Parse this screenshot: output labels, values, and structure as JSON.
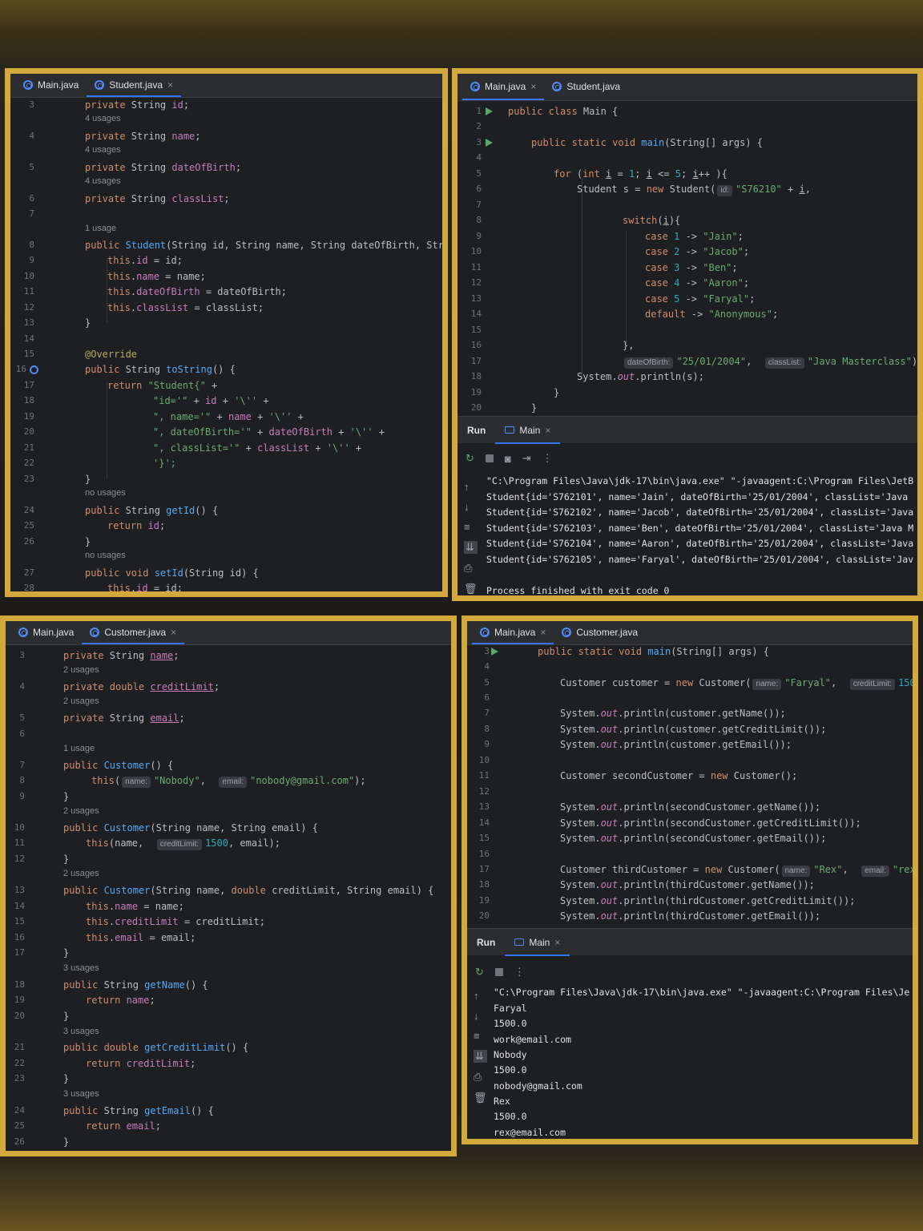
{
  "panel1": {
    "tabs": [
      {
        "label": "Main.java"
      },
      {
        "label": "Student.java",
        "close": "×"
      }
    ],
    "lines": [
      {
        "n": "3",
        "code": "private String id;",
        "hint": "4 usages"
      },
      {
        "n": "4",
        "code": "private String name;",
        "hint": "4 usages"
      },
      {
        "n": "5",
        "code": "private String dateOfBirth;",
        "hint": "4 usages"
      },
      {
        "n": "6",
        "code": "private String classList;"
      },
      {
        "n": "7",
        "code": "",
        "hint": "1 usage"
      },
      {
        "n": "8",
        "code": "public Student(String id, String name, String dateOfBirth, String"
      },
      {
        "n": "9",
        "code": "this.id = id;"
      },
      {
        "n": "10",
        "code": "this.name = name;"
      },
      {
        "n": "11",
        "code": "this.dateOfBirth = dateOfBirth;"
      },
      {
        "n": "12",
        "code": "this.classList = classList;"
      },
      {
        "n": "13",
        "code": "}"
      },
      {
        "n": "14",
        "code": ""
      },
      {
        "n": "15",
        "code": "@Override"
      },
      {
        "n": "16",
        "code": "public String toString() {"
      },
      {
        "n": "17",
        "code": "return \"Student{\" +"
      },
      {
        "n": "18",
        "code": "\"id='\" + id + '\\'' +"
      },
      {
        "n": "19",
        "code": "\", name='\" + name + '\\'' +"
      },
      {
        "n": "20",
        "code": "\", dateOfBirth='\" + dateOfBirth + '\\'' +"
      },
      {
        "n": "21",
        "code": "\", classList='\" + classList + '\\'' +"
      },
      {
        "n": "22",
        "code": "'}';"
      },
      {
        "n": "23",
        "code": "}",
        "hint": "no usages"
      },
      {
        "n": "24",
        "code": "public String getId() {"
      },
      {
        "n": "25",
        "code": "return id;"
      },
      {
        "n": "26",
        "code": "}",
        "hint": "no usages"
      },
      {
        "n": "27",
        "code": "public void setId(String id) {"
      },
      {
        "n": "28",
        "code": "this.id = id;"
      }
    ]
  },
  "panel2": {
    "tabs": [
      {
        "label": "Main.java",
        "close": "×"
      },
      {
        "label": "Student.java"
      }
    ],
    "lines": [
      {
        "n": "1",
        "code": "public class Main {"
      },
      {
        "n": "2",
        "code": ""
      },
      {
        "n": "3",
        "code": "public static void main(String[] args) {"
      },
      {
        "n": "4",
        "code": ""
      },
      {
        "n": "5",
        "code": "for (int i = 1; i <= 5; i++ ){"
      },
      {
        "n": "6",
        "code": "Student s = new Student( id: \"S76210\" + i,"
      },
      {
        "n": "7",
        "code": ""
      },
      {
        "n": "8",
        "code": "switch(i){"
      },
      {
        "n": "9",
        "code": "case 1 -> \"Jain\";"
      },
      {
        "n": "10",
        "code": "case 2 -> \"Jacob\";"
      },
      {
        "n": "11",
        "code": "case 3 -> \"Ben\";"
      },
      {
        "n": "12",
        "code": "case 4 -> \"Aaron\";"
      },
      {
        "n": "13",
        "code": "case 5 -> \"Faryal\";"
      },
      {
        "n": "14",
        "code": "default -> \"Anonymous\";"
      },
      {
        "n": "15",
        "code": ""
      },
      {
        "n": "16",
        "code": "},"
      },
      {
        "n": "17",
        "code": "dateOfBirth: \"25/01/2004\",  classList: \"Java Masterclass\");"
      },
      {
        "n": "18",
        "code": "System.out.println(s);"
      },
      {
        "n": "19",
        "code": "}"
      },
      {
        "n": "20",
        "code": "}"
      }
    ],
    "run": {
      "label": "Run",
      "tab": "Main",
      "close": "×",
      "output": [
        "\"C:\\Program Files\\Java\\jdk-17\\bin\\java.exe\" \"-javaagent:C:\\Program Files\\JetB",
        "Student{id='S762101', name='Jain', dateOfBirth='25/01/2004', classList='Java",
        "Student{id='S762102', name='Jacob', dateOfBirth='25/01/2004', classList='Java",
        "Student{id='S762103', name='Ben', dateOfBirth='25/01/2004', classList='Java M",
        "Student{id='S762104', name='Aaron', dateOfBirth='25/01/2004', classList='Java",
        "Student{id='S762105', name='Faryal', dateOfBirth='25/01/2004', classList='Jav",
        "",
        "Process finished with exit code 0"
      ]
    }
  },
  "panel3": {
    "tabs": [
      {
        "label": "Main.java"
      },
      {
        "label": "Customer.java",
        "close": "×"
      }
    ],
    "lines": [
      {
        "n": "3",
        "code": "private String name;",
        "hint": "2 usages"
      },
      {
        "n": "4",
        "code": "private double creditLimit;",
        "hint": "2 usages"
      },
      {
        "n": "5",
        "code": "private String email;"
      },
      {
        "n": "6",
        "code": "",
        "hint": "1 usage"
      },
      {
        "n": "7",
        "code": "public Customer() {"
      },
      {
        "n": "8",
        "code": "this( name: \"Nobody\",  email: \"nobody@gmail.com\");"
      },
      {
        "n": "9",
        "code": "}",
        "hint": "2 usages"
      },
      {
        "n": "10",
        "code": "public Customer(String name, String email) {"
      },
      {
        "n": "11",
        "code": "this(name,  creditLimit: 1500, email);"
      },
      {
        "n": "12",
        "code": "}",
        "hint": "2 usages"
      },
      {
        "n": "13",
        "code": "public Customer(String name, double creditLimit, String email) {"
      },
      {
        "n": "14",
        "code": "this.name = name;"
      },
      {
        "n": "15",
        "code": "this.creditLimit = creditLimit;"
      },
      {
        "n": "16",
        "code": "this.email = email;"
      },
      {
        "n": "17",
        "code": "}",
        "hint": "3 usages"
      },
      {
        "n": "18",
        "code": "public String getName() {"
      },
      {
        "n": "19",
        "code": "return name;"
      },
      {
        "n": "20",
        "code": "}",
        "hint": "3 usages"
      },
      {
        "n": "21",
        "code": "public double getCreditLimit() {"
      },
      {
        "n": "22",
        "code": "return creditLimit;"
      },
      {
        "n": "23",
        "code": "}",
        "hint": "3 usages"
      },
      {
        "n": "24",
        "code": "public String getEmail() {"
      },
      {
        "n": "25",
        "code": "return email;"
      },
      {
        "n": "26",
        "code": "}"
      }
    ]
  },
  "panel4": {
    "tabs": [
      {
        "label": "Main.java",
        "close": "×"
      },
      {
        "label": "Customer.java"
      }
    ],
    "lines": [
      {
        "n": "3",
        "code": "public static void main(String[] args) {"
      },
      {
        "n": "4",
        "code": ""
      },
      {
        "n": "5",
        "code": "Customer customer = new Customer( name: \"Faryal\",  creditLimit: 1500,"
      },
      {
        "n": "6",
        "code": ""
      },
      {
        "n": "7",
        "code": "System.out.println(customer.getName());"
      },
      {
        "n": "8",
        "code": "System.out.println(customer.getCreditLimit());"
      },
      {
        "n": "9",
        "code": "System.out.println(customer.getEmail());"
      },
      {
        "n": "10",
        "code": ""
      },
      {
        "n": "11",
        "code": "Customer secondCustomer = new Customer();"
      },
      {
        "n": "12",
        "code": ""
      },
      {
        "n": "13",
        "code": "System.out.println(secondCustomer.getName());"
      },
      {
        "n": "14",
        "code": "System.out.println(secondCustomer.getCreditLimit());"
      },
      {
        "n": "15",
        "code": "System.out.println(secondCustomer.getEmail());"
      },
      {
        "n": "16",
        "code": ""
      },
      {
        "n": "17",
        "code": "Customer thirdCustomer = new Customer( name: \"Rex\",  email: \"rex@em"
      },
      {
        "n": "18",
        "code": "System.out.println(thirdCustomer.getName());"
      },
      {
        "n": "19",
        "code": "System.out.println(thirdCustomer.getCreditLimit());"
      },
      {
        "n": "20",
        "code": "System.out.println(thirdCustomer.getEmail());"
      }
    ],
    "run": {
      "label": "Run",
      "tab": "Main",
      "close": "×",
      "output": [
        "\"C:\\Program Files\\Java\\jdk-17\\bin\\java.exe\" \"-javaagent:C:\\Program Files\\Je",
        "Faryal",
        "1500.0",
        "work@email.com",
        "Nobody",
        "1500.0",
        "nobody@gmail.com",
        "Rex",
        "1500.0",
        "rex@email.com"
      ]
    }
  },
  "icons": [
    "java-class-icon",
    "close-icon",
    "run-gutter-icon",
    "rerun-icon",
    "stop-icon",
    "camera-icon",
    "exit-icon",
    "more-icon",
    "up-arrow-icon",
    "down-arrow-icon",
    "soft-wrap-icon",
    "scroll-end-icon",
    "print-icon",
    "trash-icon",
    "override-marker-icon"
  ],
  "colors": {
    "frame": "#d2a93a",
    "editor_bg": "#1e1f22",
    "keyword": "#cf8e6d",
    "string": "#6aab73",
    "method": "#56a8f5",
    "field": "#c77dbb",
    "number": "#2aacb8",
    "annotation": "#b3ae60"
  }
}
